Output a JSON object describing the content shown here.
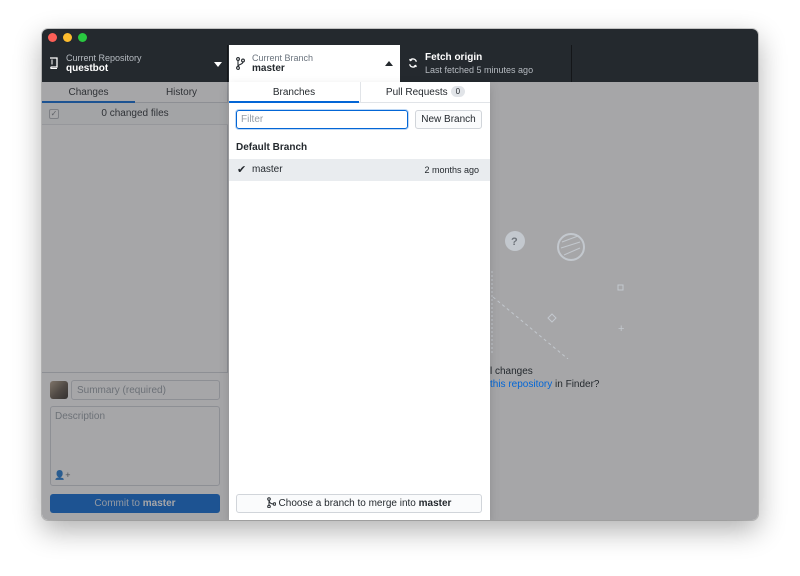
{
  "toolbar": {
    "repository": {
      "label": "Current Repository",
      "value": "questbot",
      "icon": "repo-icon"
    },
    "branch": {
      "label": "Current Branch",
      "value": "master",
      "icon": "git-branch-icon"
    },
    "fetch": {
      "title": "Fetch origin",
      "subtitle": "Last fetched 5 minutes ago",
      "icon": "sync-icon"
    }
  },
  "sidebar": {
    "tabs": [
      {
        "label": "Changes",
        "active": true
      },
      {
        "label": "History",
        "active": false
      }
    ],
    "changed_files": "0 changed files",
    "commit": {
      "summary_placeholder": "Summary (required)",
      "description_placeholder": "Description",
      "button_prefix": "Commit to ",
      "button_branch": "master"
    }
  },
  "main": {
    "no_changes_text": "l changes",
    "finder_link": "this repository",
    "finder_suffix": " in Finder?"
  },
  "branch_dropdown": {
    "tabs": [
      {
        "label": "Branches",
        "active": true
      },
      {
        "label": "Pull Requests",
        "badge": "0",
        "active": false
      }
    ],
    "filter_placeholder": "Filter",
    "new_branch_label": "New Branch",
    "section_title": "Default Branch",
    "branches": [
      {
        "name": "master",
        "age": "2 months ago",
        "checked": true
      }
    ],
    "merge_prefix": "Choose a branch to merge into ",
    "merge_branch": "master"
  },
  "colors": {
    "accent": "#0366d6",
    "toolbar": "#24292e"
  }
}
